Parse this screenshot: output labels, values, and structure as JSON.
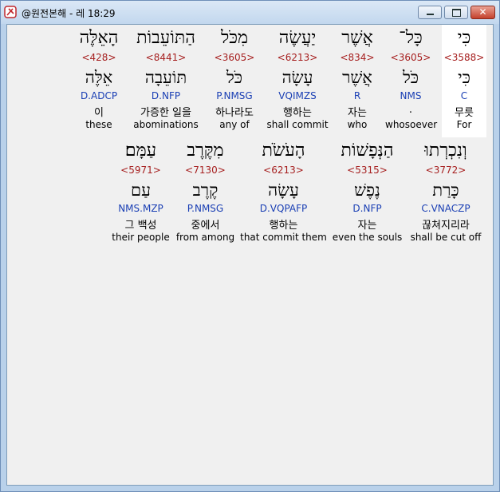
{
  "window": {
    "title": "@원전본해 - 레 18:29",
    "buttons": {
      "minimize_icon": "minimize-icon",
      "maximize_icon": "maximize-icon",
      "close_icon": "close-icon",
      "close_glyph": "✕"
    }
  },
  "rows": [
    {
      "words": [
        {
          "hebrew": "כִּי",
          "strong": "<3588>",
          "lemma": "כִּי",
          "parsing": "C",
          "korean": "무릇",
          "english": "For",
          "selected": true
        },
        {
          "hebrew": "כָּל־",
          "strong": "<3605>",
          "lemma": "כֹּל",
          "parsing": "NMS",
          "korean": ".",
          "english": "whosoever",
          "selected": false
        },
        {
          "hebrew": "אֲשֶׁר",
          "strong": "<834>",
          "lemma": "אֲשֶׁר",
          "parsing": "R",
          "korean": "자는",
          "english": "who",
          "selected": false
        },
        {
          "hebrew": "יַעֲשֶׂה",
          "strong": "<6213>",
          "lemma": "עָשָׂה",
          "parsing": "VQIMZS",
          "korean": "행하는",
          "english": "shall commit",
          "selected": false
        },
        {
          "hebrew": "מִכֹּל",
          "strong": "<3605>",
          "lemma": "כֹּל",
          "parsing": "P.NMSG",
          "korean": "하나라도",
          "english": "any of",
          "selected": false
        },
        {
          "hebrew": "הַתּוֹעֵבוֹת",
          "strong": "<8441>",
          "lemma": "תּוֹעֵבָה",
          "parsing": "D.NFP",
          "korean": "가증한 일을",
          "english": "abominations",
          "selected": false
        },
        {
          "hebrew": "הָאֵלֶּה",
          "strong": "<428>",
          "lemma": "אֵלֶּה",
          "parsing": "D.ADCP",
          "korean": "이",
          "english": "these",
          "selected": false
        }
      ]
    },
    {
      "words": [
        {
          "hebrew": "וְנִכְרְתוּ",
          "strong": "<3772>",
          "lemma": "כָּרַת",
          "parsing": "C.VNACZP",
          "korean": "끊쳐지리라",
          "english": "shall be cut off"
        },
        {
          "hebrew": "הַנְּפָשׁוֹת",
          "strong": "<5315>",
          "lemma": "נֶפֶשׁ",
          "parsing": "D.NFP",
          "korean": "자는",
          "english": "even the souls"
        },
        {
          "hebrew": "הָעֹשֹׂת",
          "strong": "<6213>",
          "lemma": "עָשָׂה",
          "parsing": "D.VQPAFP",
          "korean": "행하는",
          "english": "that commit them"
        },
        {
          "hebrew": "מִקֶּרֶב",
          "strong": "<7130>",
          "lemma": "קֶרֶב",
          "parsing": "P.NMSG",
          "korean": "중에서",
          "english": "from among"
        },
        {
          "hebrew": "עַמָּם׃",
          "strong": "<5971>",
          "lemma": "עַם",
          "parsing": "NMS.MZP",
          "korean": "그 백성",
          "english": "their people"
        }
      ]
    }
  ]
}
